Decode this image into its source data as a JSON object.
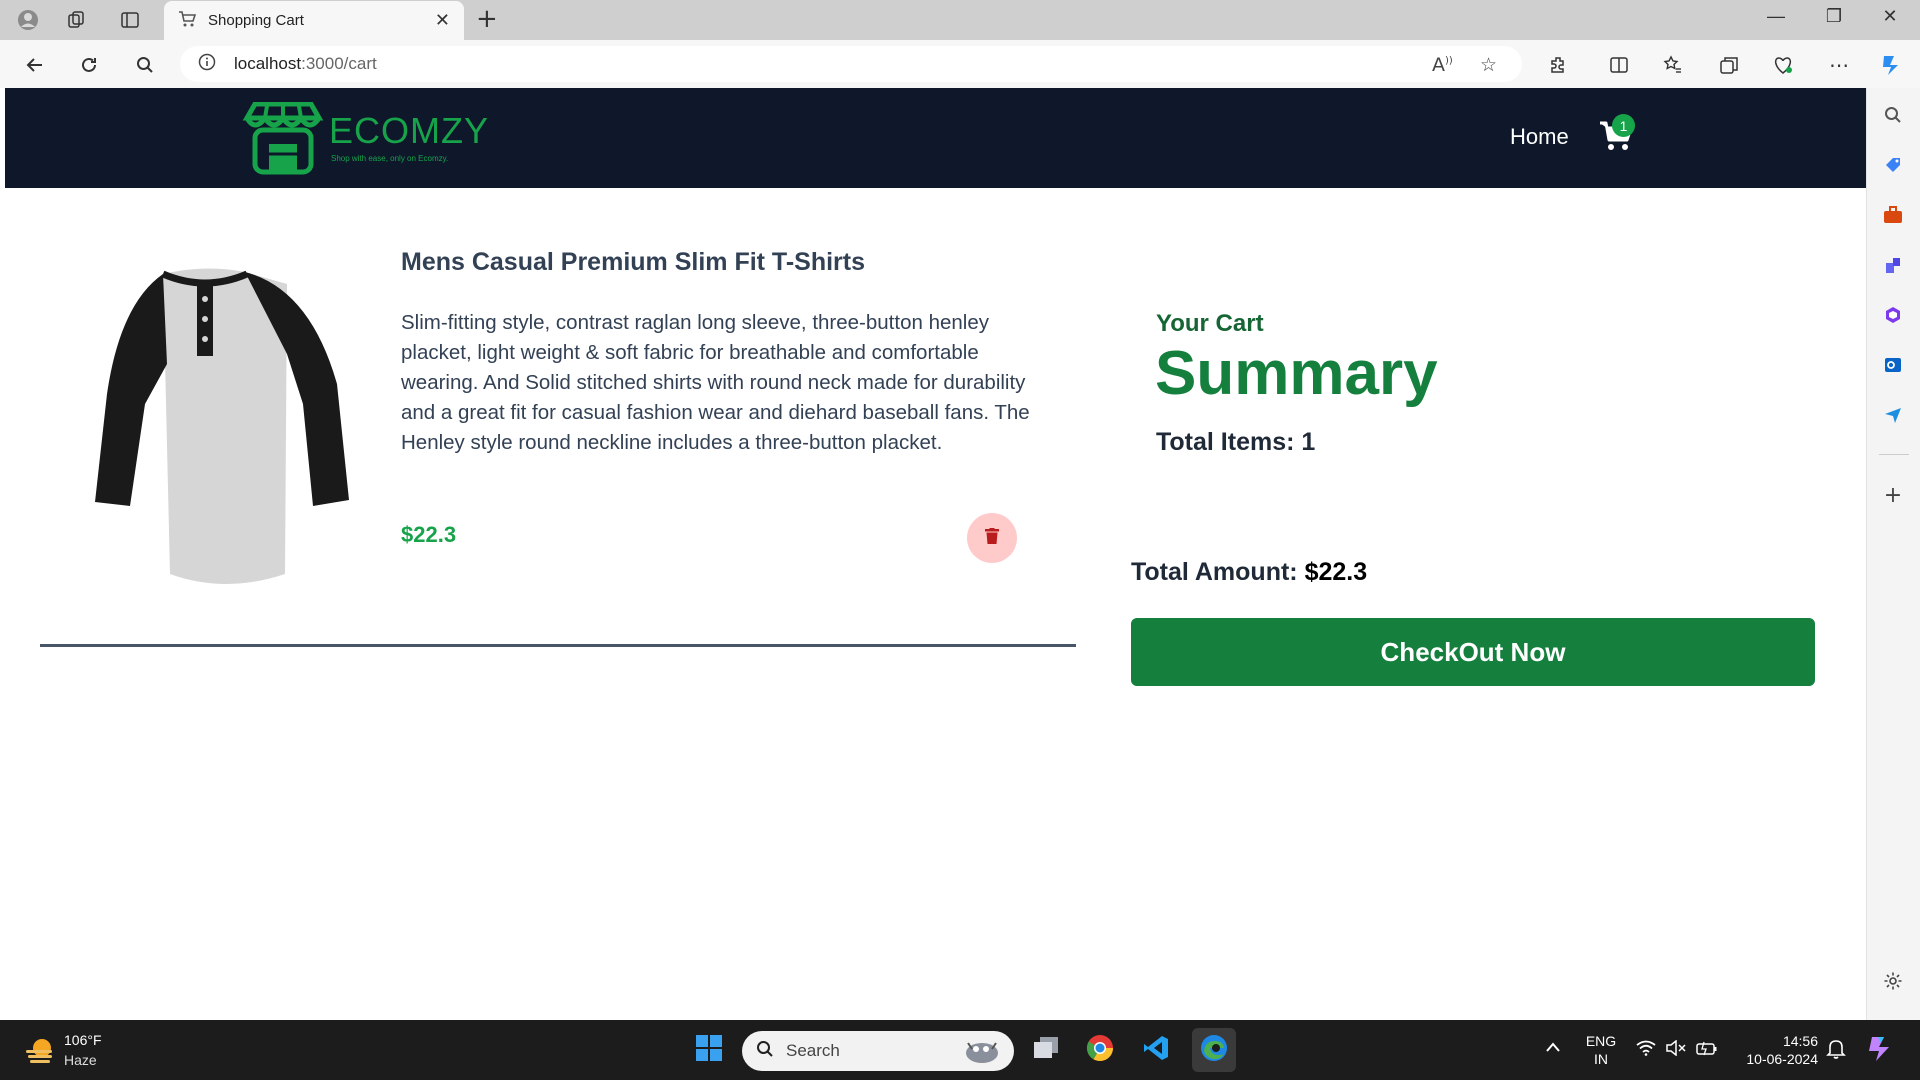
{
  "browser": {
    "tab_title": "Shopping Cart",
    "url_host": "localhost",
    "url_path": ":3000/cart"
  },
  "navbar": {
    "brand_name": "ECOMZY",
    "brand_tagline": "Shop with ease, only on Ecomzy.",
    "home_label": "Home",
    "cart_count": "1"
  },
  "cart_item": {
    "title": "Mens Casual Premium Slim Fit T-Shirts",
    "description": "Slim-fitting style, contrast raglan long sleeve, three-button henley placket, light weight & soft fabric for breathable and comfortable wearing. And Solid stitched shirts with round neck made for durability and a great fit for casual fashion wear and diehard baseball fans. The Henley style round neckline includes a three-button placket.",
    "price": "$22.3"
  },
  "summary": {
    "label": "Your Cart",
    "title": "Summary",
    "total_items": "Total Items: 1",
    "total_amount_label": "Total Amount: ",
    "total_amount_value": "$22.3",
    "checkout_label": "CheckOut Now"
  },
  "taskbar": {
    "weather_temp": "106°F",
    "weather_condition": "Haze",
    "search_placeholder": "Search",
    "lang_1": "ENG",
    "lang_2": "IN",
    "time": "14:56",
    "date": "10-06-2024"
  },
  "colors": {
    "navbar_bg": "#0f172a",
    "accent_green": "#15803d",
    "price_green": "#16a34a",
    "delete_bg": "#fecaca",
    "delete_icon": "#b91c1c"
  }
}
